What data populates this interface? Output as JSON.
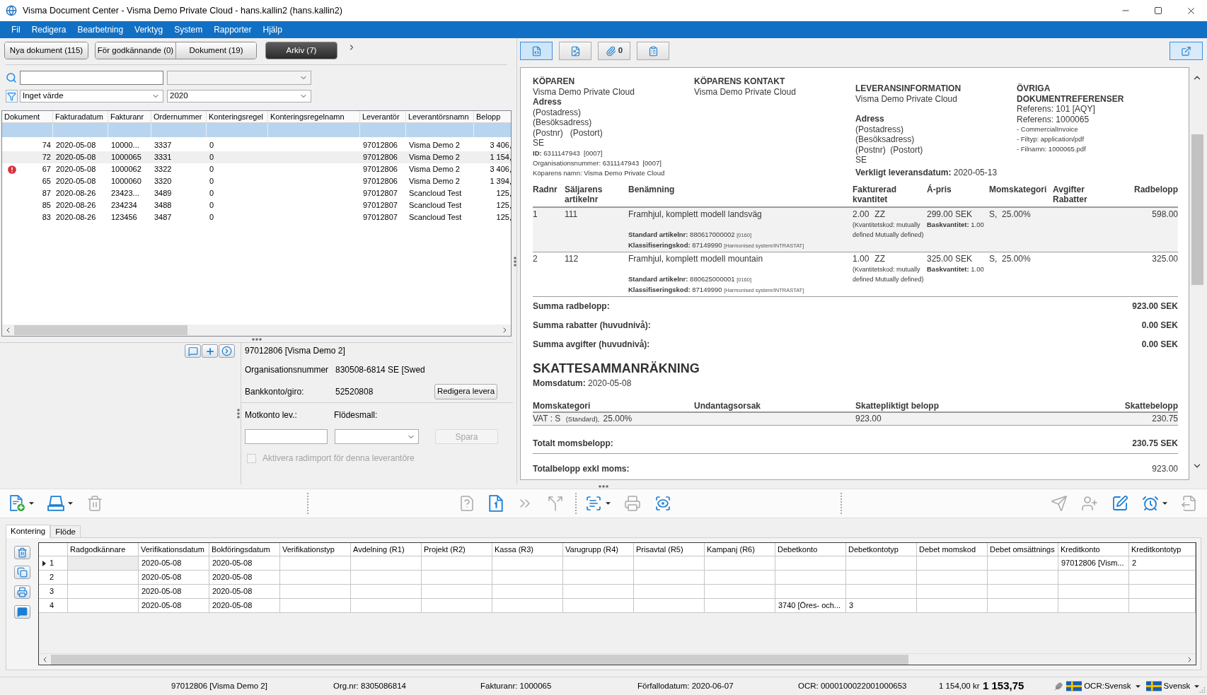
{
  "window": {
    "title": "Visma Document Center - Visma Demo Private Cloud - hans.kallin2 (hans.kallin2)"
  },
  "menu": [
    "Fil",
    "Redigera",
    "Bearbetning",
    "Verktyg",
    "System",
    "Rapporter",
    "Hjälp"
  ],
  "view_tabs": [
    {
      "label": "Nya dokument (115)",
      "selected": false
    },
    {
      "label": "För godkännande (0)",
      "selected": false
    },
    {
      "label": "Dokument (19)",
      "selected": false
    },
    {
      "label": "Arkiv (7)",
      "selected": true
    }
  ],
  "filters": {
    "filter": "Inget värde",
    "year": "2020"
  },
  "documents": {
    "columns": [
      "Dokument",
      "Fakturadatum",
      "Fakturanr",
      "Ordernummer",
      "Konteringsregel",
      "Konteringsregelnamn",
      "Leverantör",
      "Leverantörsnamn",
      "Belopp"
    ],
    "rows": [
      {
        "dokument": "74",
        "fakturadatum": "2020-05-08",
        "fakturanr": "10000...",
        "ordernummer": "3337",
        "konteringsregel": "0",
        "leverantor": "97012806",
        "leverantorsnamn": "Visma Demo 2",
        "belopp": "3 406,",
        "warning": false,
        "selected": false
      },
      {
        "dokument": "72",
        "fakturadatum": "2020-05-08",
        "fakturanr": "1000065",
        "ordernummer": "3331",
        "konteringsregel": "0",
        "leverantor": "97012806",
        "leverantorsnamn": "Visma Demo 2",
        "belopp": "1 154,",
        "warning": false,
        "selected": true
      },
      {
        "dokument": "67",
        "fakturadatum": "2020-05-08",
        "fakturanr": "1000062",
        "ordernummer": "3322",
        "konteringsregel": "0",
        "leverantor": "97012806",
        "leverantorsnamn": "Visma Demo 2",
        "belopp": "3 406,",
        "warning": true,
        "selected": false
      },
      {
        "dokument": "65",
        "fakturadatum": "2020-05-08",
        "fakturanr": "1000060",
        "ordernummer": "3320",
        "konteringsregel": "0",
        "leverantor": "97012806",
        "leverantorsnamn": "Visma Demo 2",
        "belopp": "1 394,",
        "warning": false,
        "selected": false
      },
      {
        "dokument": "87",
        "fakturadatum": "2020-08-26",
        "fakturanr": "23423...",
        "ordernummer": "3489",
        "konteringsregel": "0",
        "leverantor": "97012807",
        "leverantorsnamn": "Scancloud Test",
        "belopp": "125,",
        "warning": false,
        "selected": false
      },
      {
        "dokument": "85",
        "fakturadatum": "2020-08-26",
        "fakturanr": "234234",
        "ordernummer": "3488",
        "konteringsregel": "0",
        "leverantor": "97012807",
        "leverantorsnamn": "Scancloud Test",
        "belopp": "125,",
        "warning": false,
        "selected": false
      },
      {
        "dokument": "83",
        "fakturadatum": "2020-08-26",
        "fakturanr": "123456",
        "ordernummer": "3487",
        "konteringsregel": "0",
        "leverantor": "97012807",
        "leverantorsnamn": "Scancloud Test",
        "belopp": "125,",
        "warning": false,
        "selected": false
      }
    ]
  },
  "supplier_panel": {
    "title": "97012806 [Visma Demo 2]",
    "fields": [
      {
        "label": "Organisationsnummer",
        "value": "830508-6814 SE [Swed"
      },
      {
        "label": "Bankkonto/giro:",
        "value": "52520808"
      }
    ],
    "edit_button": "Redigera levera",
    "account": {
      "label": "Motkonto lev.:"
    },
    "flow_template": {
      "label": "Flödesmall:"
    },
    "save_button": {
      "label": "Spara",
      "disabled": true
    },
    "line_import": {
      "label": "Aktivera radimport för denna leverantöre",
      "checked": false,
      "disabled": true
    }
  },
  "viewer_tabs": [
    {
      "kind": "xml",
      "selected": true
    },
    {
      "kind": "image",
      "selected": false
    },
    {
      "kind": "attachments",
      "selected": false,
      "count": "0"
    },
    {
      "kind": "history",
      "selected": false
    }
  ],
  "invoice": {
    "parties": [
      {
        "title": "KÖPAREN",
        "lines": [
          {
            "kind": "text",
            "text": "Visma Demo Private Cloud"
          },
          {
            "kind": "bold",
            "text": "Adress"
          },
          {
            "kind": "text",
            "text": "(Postadress)"
          },
          {
            "kind": "text",
            "text": "(Besöksadress)"
          },
          {
            "kind": "text",
            "text": "(Postnr)   (Postort)"
          },
          {
            "kind": "text",
            "text": "SE"
          },
          {
            "kind": "small",
            "text": "**ID:** 6311147943  [0007]"
          },
          {
            "kind": "small",
            "text": "Organisationsnummer: 6311147943  [0007]"
          },
          {
            "kind": "small",
            "text": "Köparens namn: Visma Demo Private Cloud"
          }
        ]
      },
      {
        "title": "KÖPARENS KONTAKT",
        "lines": [
          {
            "kind": "text",
            "text": "Visma Demo Private Cloud"
          }
        ]
      },
      {
        "title": "LEVERANSINFORMATION",
        "lines": [
          {
            "kind": "text",
            "text": "Visma Demo Private Cloud"
          },
          {
            "kind": "spacer"
          },
          {
            "kind": "bold",
            "text": "Adress"
          },
          {
            "kind": "text",
            "text": "(Postadress)"
          },
          {
            "kind": "text",
            "text": "(Besöksadress)"
          },
          {
            "kind": "text",
            "text": "(Postnr)  (Postort)"
          },
          {
            "kind": "text",
            "text": "SE"
          },
          {
            "kind": "date",
            "text": "**Verkligt leveransdatum:** 2020-05-13"
          }
        ]
      },
      {
        "title": "ÖVRIGA DOKUMENTREFERENSER",
        "lines": [
          {
            "kind": "text",
            "text": "Referens: 101 [AQY]"
          },
          {
            "kind": "text",
            "text": "Referens: 1000065"
          },
          {
            "kind": "small",
            "text": "- CommercialInvoice"
          },
          {
            "kind": "small",
            "text": "- Filtyp: application/pdf"
          },
          {
            "kind": "small",
            "text": "- Filnamn: 1000065.pdf"
          }
        ]
      }
    ],
    "lines": {
      "columns": [
        "Radnr",
        "Säljarens artikelnr",
        "Benämning",
        "Fakturerad kvantitet",
        "Á-pris",
        "Momskategori",
        "Avgifter Rabatter",
        "Radbelopp"
      ],
      "rows": [
        {
          "radnr": "1",
          "artikelnr": "111",
          "name": "Framhjul, komplett modell landsväg",
          "details": [
            {
              "label": "Standard artikelnr:",
              "value": "880617000002",
              "scheme": "[0160]"
            },
            {
              "label": "Klassifiseringskod:",
              "value": "87149990",
              "scheme": "[Harmonised system/INTRASTAT]"
            }
          ],
          "quantity": "2.00",
          "unit": "ZZ",
          "quantity_note": "(Kvantitetskod: mutually defined Mutually defined)",
          "price": "299.00 SEK",
          "base_quantity": "**Baskvantitet:** 1.00",
          "vat": "S,  25.00%",
          "amount": "598.00"
        },
        {
          "radnr": "2",
          "artikelnr": "112",
          "name": "Framhjul, komplett modell mountain",
          "details": [
            {
              "label": "Standard artikelnr:",
              "value": "880625000001",
              "scheme": "[0160]"
            },
            {
              "label": "Klassifiseringskod:",
              "value": "87149990",
              "scheme": "[Harmonised system/INTRASTAT]"
            }
          ],
          "quantity": "1.00",
          "unit": "ZZ",
          "quantity_note": "(Kvantitetskod: mutually defined Mutually defined)",
          "price": "325.00 SEK",
          "base_quantity": "**Baskvantitet:** 1.00",
          "vat": "S,  25.00%",
          "amount": "325.00"
        }
      ]
    },
    "totals": [
      {
        "label": "Summa radbelopp:",
        "value": "923.00 SEK"
      },
      {
        "label": "Summa rabatter (huvudnivå):",
        "value": "0.00 SEK"
      },
      {
        "label": "Summa avgifter (huvudnivå):",
        "value": "0.00 SEK"
      }
    ],
    "tax_summary": {
      "title": "SKATTESAMMANRÄKNING",
      "date": "**Momsdatum:** 2020-05-08",
      "columns": [
        "Momskategori",
        "Undantagsorsak",
        "Skattepliktigt belopp",
        "Skattebelopp"
      ],
      "rows": [
        {
          "category": "VAT : S",
          "category_note": "(Standard),",
          "rate": "25.00%",
          "taxable": "923.00",
          "tax": "230.75"
        }
      ]
    },
    "grand_totals": [
      {
        "label": "Totalt momsbelopp:",
        "value": "230.75 SEK",
        "bold": true
      },
      {
        "label": "Totalbelopp exkl moms:",
        "value": "923.00",
        "bold": false
      }
    ]
  },
  "toolbar": {
    "groups": [
      {
        "items": [
          {
            "kind": "new",
            "disabled": false,
            "dropdown": true
          },
          {
            "kind": "scan",
            "disabled": false,
            "dropdown": true
          },
          {
            "kind": "delete",
            "disabled": true,
            "dropdown": false
          }
        ]
      },
      {
        "items": [
          {
            "kind": "unknown_doc",
            "disabled": true,
            "dropdown": false
          },
          {
            "kind": "page",
            "disabled": false,
            "dropdown": false
          },
          {
            "kind": "forward",
            "disabled": true,
            "dropdown": false
          },
          {
            "kind": "split",
            "disabled": true,
            "dropdown": false
          }
        ]
      },
      {
        "items": [
          {
            "kind": "ocr",
            "disabled": false,
            "dropdown": true
          },
          {
            "kind": "print",
            "disabled": true,
            "dropdown": false
          },
          {
            "kind": "preview",
            "disabled": false,
            "dropdown": false
          }
        ]
      },
      {
        "items": [
          {
            "kind": "send",
            "disabled": true,
            "dropdown": false
          },
          {
            "kind": "add_user",
            "disabled": true,
            "dropdown": false
          },
          {
            "kind": "edit",
            "disabled": false,
            "dropdown": false
          },
          {
            "kind": "reminder",
            "disabled": false,
            "dropdown": true
          },
          {
            "kind": "export",
            "disabled": true,
            "dropdown": false
          }
        ]
      }
    ]
  },
  "bottom_tabs": [
    {
      "label": "Kontering",
      "selected": true
    },
    {
      "label": "Flöde",
      "selected": false
    }
  ],
  "postings": {
    "columns": [
      "Radgodkännare",
      "Verifikationsdatum",
      "Bokföringsdatum",
      "Verifikationstyp",
      "Avdelning (R1)",
      "Projekt (R2)",
      "Kassa (R3)",
      "Varugrupp (R4)",
      "Prisavtal (R5)",
      "Kampanj (R6)",
      "Debetkonto",
      "Debetkontotyp",
      "Debet momskod",
      "Debet omsättnings",
      "Kreditkonto",
      "Kreditkontotyp"
    ],
    "rows": [
      {
        "row": "1",
        "verifikationsdatum": "2020-05-08",
        "bokforingsdatum": "2020-05-08",
        "kreditkonto": "97012806 [Vism...",
        "kreditkontotyp": "2",
        "selected": true
      },
      {
        "row": "2",
        "verifikationsdatum": "2020-05-08",
        "bokforingsdatum": "2020-05-08",
        "selected": false
      },
      {
        "row": "3",
        "verifikationsdatum": "2020-05-08",
        "bokforingsdatum": "2020-05-08",
        "selected": false
      },
      {
        "row": "4",
        "verifikationsdatum": "2020-05-08",
        "bokforingsdatum": "2020-05-08",
        "debetkonto": "3740 [Öres- och...",
        "debetkontotyp": "3",
        "selected": false
      }
    ]
  },
  "status_bar": {
    "supplier": "97012806 [Visma Demo 2]",
    "org_nr": "Org.nr: 8305086814",
    "invoice_no": "Fakturanr: 1000065",
    "due_date": "Förfallodatum: 2020-06-07",
    "ocr": "OCR: 0000100022001000653",
    "amount": "1 154,00 kr",
    "total": "1 153,75",
    "ocr_language": "OCR:Svensk",
    "language": "Svensk"
  }
}
